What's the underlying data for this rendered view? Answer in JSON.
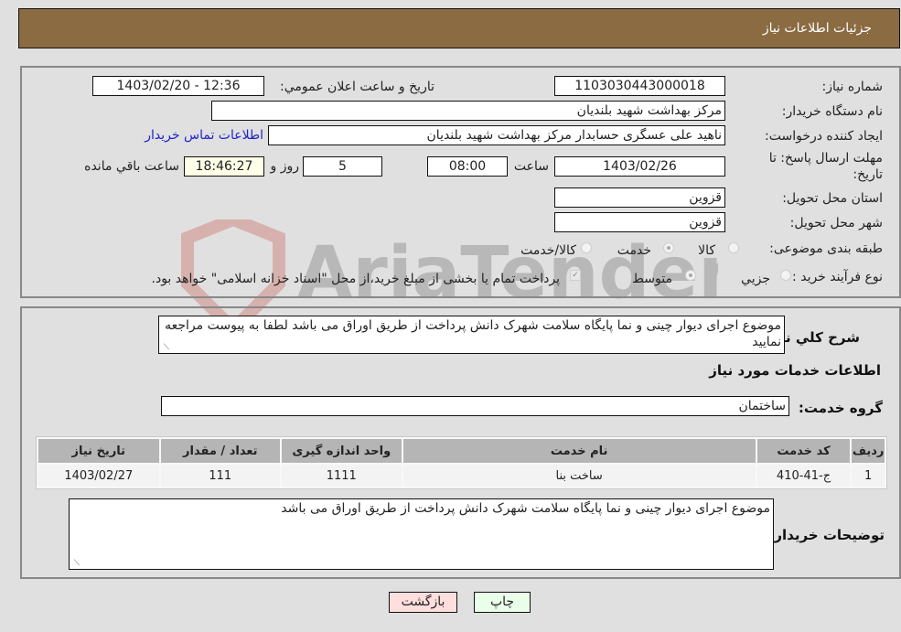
{
  "header": {
    "title": "جزئیات اطلاعات نیاز"
  },
  "form": {
    "need_number": {
      "label": "شماره نیاز:",
      "value": "1103030443000018"
    },
    "announce_datetime": {
      "label": "تاریخ و ساعت اعلان عمومي:",
      "value": "1403/02/20 - 12:36"
    },
    "buyer_org": {
      "label": "نام دستگاه خریدار:",
      "value": "مرکز بهداشت شهید بلندیان"
    },
    "requester": {
      "label": "ایجاد کننده درخواست:",
      "value": "ناهید علی عسگری حسابدار مرکز بهداشت شهید بلندیان",
      "contact_link": "اطلاعات تماس خریدار"
    },
    "deadline": {
      "label": "مهلت ارسال پاسخ: تا تاریخ:",
      "date": "1403/02/26",
      "time_label": "ساعت",
      "time": "08:00",
      "days": "5",
      "days_label": "روز و",
      "remaining": "18:46:27",
      "remaining_label": "ساعت باقي مانده"
    },
    "province": {
      "label": "استان محل تحویل:",
      "value": "قزوین"
    },
    "city": {
      "label": "شهر محل تحویل:",
      "value": "قزوین"
    },
    "category": {
      "label": "طبقه بندی موضوعی:",
      "options": [
        "کالا",
        "خدمت",
        "کالا/خدمت"
      ],
      "selected": "خدمت"
    },
    "purchase_type": {
      "label": "نوع فرآیند خرید :",
      "options": [
        "جزيي",
        "متوسط"
      ],
      "selected": "متوسط",
      "treasury_note": "پرداخت تمام یا بخشی از مبلغ خرید،از محل \"اسناد خزانه اسلامی\" خواهد بود.",
      "treasury_checked": true
    }
  },
  "description": {
    "label": "شرح کلي نیاز:",
    "value": "موضوع اجرای دیوار چینی و نما پایگاه سلامت شهرک دانش پرداخت از طریق اوراق می باشد  لطفا به پیوست مراجعه نمایید"
  },
  "services": {
    "section_title": "اطلاعات خدمات مورد نیاز",
    "group_label": "گروه خدمت:",
    "group_value": "ساختمان",
    "table": {
      "headers": [
        "ردیف",
        "کد خدمت",
        "نام خدمت",
        "واحد اندازه گیری",
        "تعداد / مقدار",
        "تاریخ نیاز"
      ],
      "rows": [
        [
          "1",
          "ج-41-410",
          "ساخت بنا",
          "1111",
          "111",
          "1403/02/27"
        ]
      ]
    }
  },
  "buyer_notes": {
    "label": "توضیحات خریدار:",
    "value": "موضوع اجرای دیوار چینی و نما پایگاه سلامت شهرک دانش پرداخت از طریق اوراق می باشد"
  },
  "buttons": {
    "print": "چاپ",
    "back": "بازگشت"
  },
  "watermark": {
    "text": "AriaTender.neT"
  },
  "colors": {
    "header_bg": "#8b6b41",
    "print_bg": "#eaffea",
    "back_bg": "#ffdede",
    "link": "#2222cc"
  }
}
